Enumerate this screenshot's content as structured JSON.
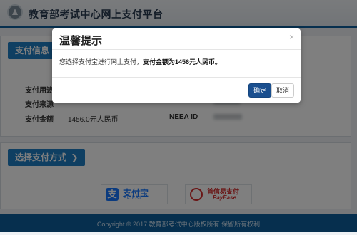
{
  "header": {
    "site_title": "教育部考试中心网上支付平台"
  },
  "payment_info": {
    "section_label": "支付信息",
    "rows": [
      {
        "label": "支付用途"
      },
      {
        "label": "支付来源"
      },
      {
        "label": "支付金额",
        "value": "1456.0元人民币",
        "extra_label": "NEEA ID"
      }
    ]
  },
  "payment_method": {
    "section_label": "选择支付方式",
    "arrow": "❯",
    "options": [
      {
        "name": "支付宝",
        "sub": "ALIPAY",
        "icon": "alipay-icon"
      },
      {
        "name": "首信易支付",
        "sub": "PayEase",
        "icon": "payease-icon"
      }
    ]
  },
  "footer": {
    "text": "Copyright © 2017 教育部考试中心版权所有 保留所有权利"
  },
  "dialog": {
    "title": "温馨提示",
    "close_glyph": "×",
    "message_prefix": "您选择支付宝进行网上支付，",
    "message_bold": "支付金额为1456元人民币。",
    "confirm_label": "确定",
    "cancel_label": "取消",
    "primary_color": "#1a4f8f"
  },
  "colors": {
    "brand_blue": "#1f7ec4",
    "footer_blue": "#0d5f9c",
    "overlay": "rgba(0,0,0,0.5)"
  }
}
